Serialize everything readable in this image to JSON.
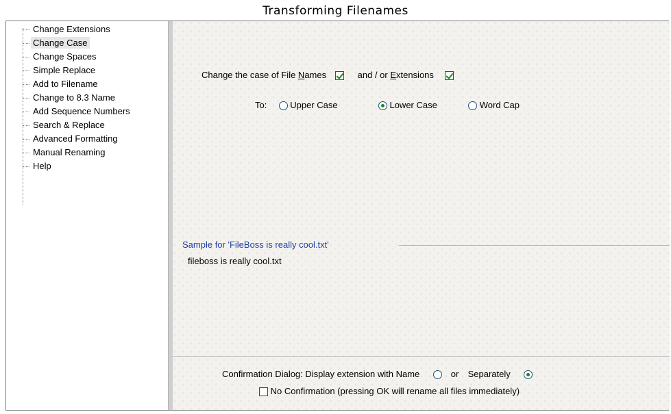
{
  "window_title": "Transforming Filenames",
  "tree": {
    "items": [
      {
        "label": "Change Extensions",
        "selected": false
      },
      {
        "label": "Change Case",
        "selected": true
      },
      {
        "label": "Change Spaces",
        "selected": false
      },
      {
        "label": "Simple Replace",
        "selected": false
      },
      {
        "label": "Add to Filename",
        "selected": false
      },
      {
        "label": "Change to 8.3 Name",
        "selected": false
      },
      {
        "label": "Add Sequence Numbers",
        "selected": false
      },
      {
        "label": "Search & Replace",
        "selected": false
      },
      {
        "label": "Advanced Formatting",
        "selected": false
      },
      {
        "label": "Manual Renaming",
        "selected": false
      },
      {
        "label": "Help",
        "selected": false
      }
    ]
  },
  "case_panel": {
    "change_label_pre": "Change the case of File ",
    "change_label_ul": "N",
    "change_label_post": "ames",
    "file_names_checked": true,
    "andor_pre": "and / or ",
    "andor_ul": "E",
    "andor_post": "xtensions",
    "extensions_checked": true,
    "to_label": "To:",
    "options": [
      {
        "label": "Upper Case",
        "selected": false
      },
      {
        "label": "Lower Case",
        "selected": true
      },
      {
        "label": "Word Cap",
        "selected": false
      }
    ]
  },
  "sample": {
    "label": "Sample for 'FileBoss is really cool.txt'",
    "result": "fileboss is really cool.txt"
  },
  "confirmation": {
    "label": "Confirmation Dialog: Display extension with Name",
    "or_label": "or",
    "separately_label": "Separately",
    "with_name_selected": false,
    "separately_selected": true,
    "no_confirmation_label": "No Confirmation (pressing OK will rename all files immediately)",
    "no_confirmation_checked": false
  },
  "colors": {
    "sample_label": "#1f3fa8",
    "check_mark": "#1a8a1a",
    "control_border": "#1c5180",
    "panel_bg": "#f3f2ee"
  }
}
